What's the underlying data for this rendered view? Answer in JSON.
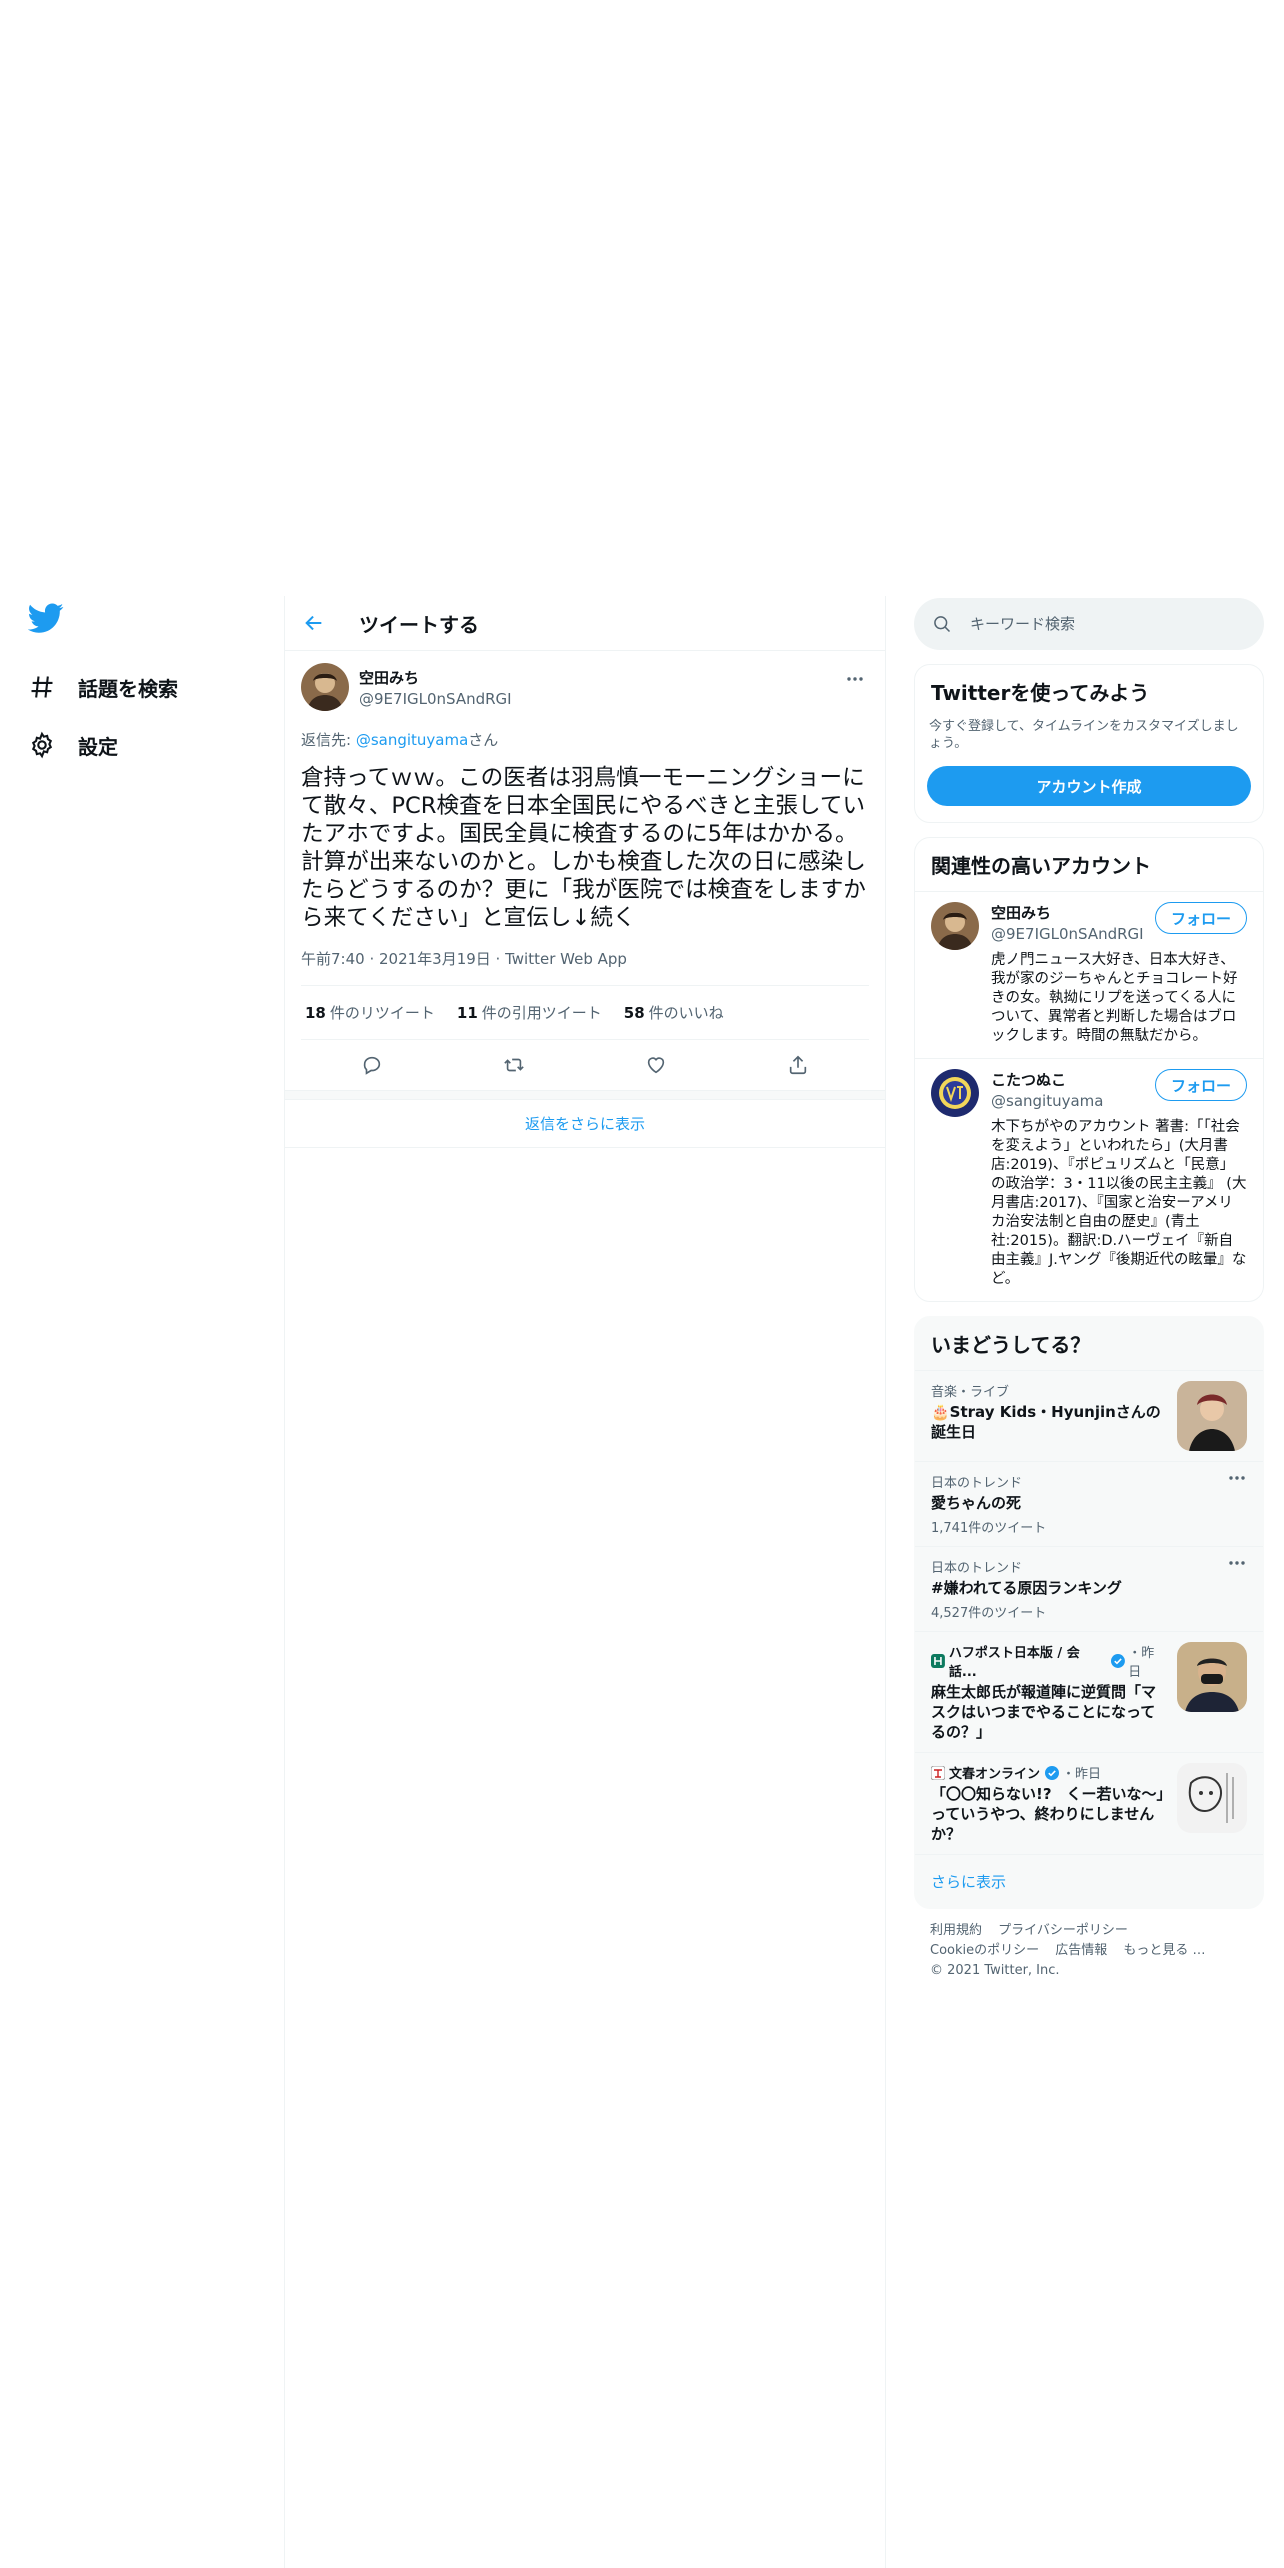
{
  "nav": {
    "items": [
      {
        "label": "話題を検索",
        "icon": "hashtag-icon"
      },
      {
        "label": "設定",
        "icon": "gear-icon"
      }
    ]
  },
  "main": {
    "header_title": "ツイートする",
    "tweet": {
      "name": "空田みち",
      "handle": "@9E7IGL0nSAndRGI",
      "reply_prefix": "返信先: ",
      "reply_handle": "@sangituyama",
      "reply_suffix": "さん",
      "text": "倉持ってｗｗ。この医者は羽鳥慎一モーニングショーにて散々、PCR検査を日本全国民にやるべきと主張していたアホですよ。国民全員に検査するのに5年はかかる。計算が出来ないのかと。しかも検査した次の日に感染したらどうするのか？更に「我が医院では検査をしますから来てください」と宣伝し↓続く",
      "meta": "午前7:40 · 2021年3月19日 · Twitter Web App",
      "retweets_num": "18",
      "retweets_label": "件のリツイート",
      "quotes_num": "11",
      "quotes_label": "件の引用ツイート",
      "likes_num": "58",
      "likes_label": "件のいいね"
    },
    "show_more_replies": "返信をさらに表示"
  },
  "side": {
    "search_placeholder": "キーワード検索",
    "signup": {
      "title": "Twitterを使ってみよう",
      "sub": "今すぐ登録して、タイムラインをカスタマイズしましょう。",
      "button": "アカウント作成"
    },
    "related": {
      "title": "関連性の高いアカウント",
      "accounts": [
        {
          "name": "空田みち",
          "handle": "@9E7IGL0nSAndRGI",
          "follow": "フォロー",
          "bio": "虎ノ門ニュース大好き、日本大好き、我が家のジーちゃんとチョコレート好きの女。執拗にリプを送ってくる人について、異常者と判断した場合はブロックします。時間の無駄だから。"
        },
        {
          "name": "こたつぬこ",
          "handle": "@sangituyama",
          "follow": "フォロー",
          "bio": "木下ちがやのアカウント 著書:「「社会を変えよう」といわれたら」(大月書店:2019)、『ポピュリズムと「民意」の政治学：3・11以後の民主主義』 (大月書店:2017)、『国家と治安ーアメリカ治安法制と自由の歴史』(青土社:2015)。翻訳:D.ハーヴェイ『新自由主義』J.ヤング『後期近代の眩暈』など。"
        }
      ]
    },
    "trends": {
      "title": "いまどうしてる？",
      "items": [
        {
          "context": "音楽・ライブ",
          "title": "🎂Stray Kids・Hyunjinさんの誕生日"
        },
        {
          "context": "日本のトレンド",
          "title": "愛ちゃんの死",
          "count": "1,741件のツイート"
        },
        {
          "context": "日本のトレンド",
          "title": "#嫌われてる原因ランキング",
          "count": "4,527件のツイート"
        },
        {
          "source": "ハフポスト日本版 / 会話...",
          "time": "・昨日",
          "title": "麻生太郎氏が報道陣に逆質問「マスクはいつまでやることになってるの？」"
        },
        {
          "source": "文春オンライン",
          "time": "・昨日",
          "title": "「〇〇知らない!?　くー若いな～」っていうやつ、終わりにしませんか？"
        }
      ],
      "show_more": "さらに表示"
    },
    "footer": {
      "line1": [
        "利用規約",
        "プライバシーポリシー"
      ],
      "line2": [
        "Cookieのポリシー",
        "広告情報",
        "もっと見る …"
      ],
      "copyright": "© 2021 Twitter, Inc."
    }
  },
  "colors": {
    "accent": "#1d9bf0",
    "text": "#0f1419",
    "muted": "#536471",
    "border": "#eff3f4"
  }
}
